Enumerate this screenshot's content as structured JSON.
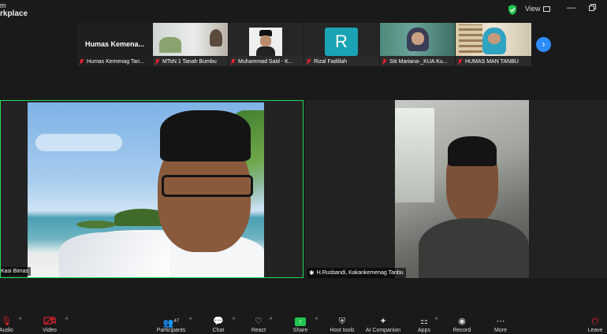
{
  "window": {
    "title_line1": "m",
    "title_line2": "rkplace",
    "view_label": "View"
  },
  "thumbnails": [
    {
      "name": "Humas Kemenag Tan...",
      "caption": "Humas  Kemena..."
    },
    {
      "name": "MTsN 1 Tanah Bumbu"
    },
    {
      "name": "Muhammad Said - K..."
    },
    {
      "name": "Rizal Fadillah",
      "initial": "R"
    },
    {
      "name": "Siti Mariana-_KUA Ku..."
    },
    {
      "name": "HUMAS MAN TANBU"
    }
  ],
  "tiles": [
    {
      "name": "Kasi Bimas"
    },
    {
      "name": "H.Rusbandi, Kakankemenag Tanbu"
    }
  ],
  "toolbar": {
    "audio": "Audio",
    "video": "Video",
    "participants": "Participants",
    "participants_count": "47",
    "chat": "Chat",
    "react": "React",
    "share": "Share",
    "host_tools": "Host tools",
    "ai_companion": "AI Companion",
    "apps": "Apps",
    "record": "Record",
    "more": "More",
    "leave": "Leave"
  },
  "colors": {
    "accent": "#2d8cff",
    "active_speaker": "#23d959",
    "share": "#23c552",
    "mute": "#e0232e"
  }
}
